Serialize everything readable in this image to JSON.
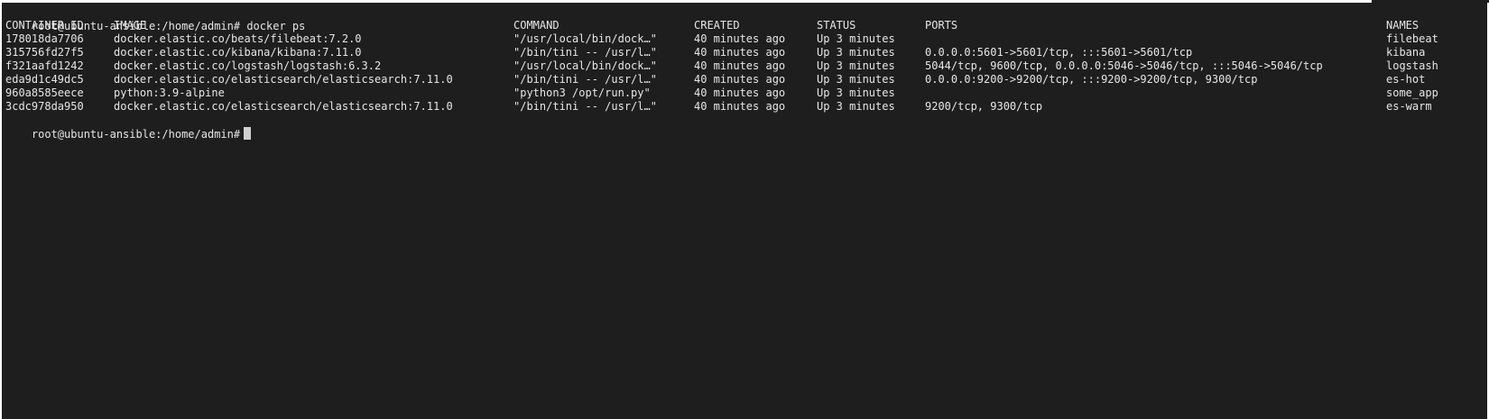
{
  "terminal": {
    "first_prompt": "root@ubuntu-ansible:/home/admin# docker ps",
    "last_prompt": "root@ubuntu-ansible:/home/admin#",
    "headers": {
      "container_id": "CONTAINER ID",
      "image": "IMAGE",
      "command": "COMMAND",
      "created": "CREATED",
      "status": "STATUS",
      "ports": "PORTS",
      "names": "NAMES"
    },
    "rows": [
      {
        "container_id": "178018da7706",
        "image": "docker.elastic.co/beats/filebeat:7.2.0",
        "command": "\"/usr/local/bin/dock…\"",
        "created": "40 minutes ago",
        "status": "Up 3 minutes",
        "ports": "",
        "names": "filebeat"
      },
      {
        "container_id": "315756fd27f5",
        "image": "docker.elastic.co/kibana/kibana:7.11.0",
        "command": "\"/bin/tini -- /usr/l…\"",
        "created": "40 minutes ago",
        "status": "Up 3 minutes",
        "ports": "0.0.0.0:5601->5601/tcp, :::5601->5601/tcp",
        "names": "kibana"
      },
      {
        "container_id": "f321aafd1242",
        "image": "docker.elastic.co/logstash/logstash:6.3.2",
        "command": "\"/usr/local/bin/dock…\"",
        "created": "40 minutes ago",
        "status": "Up 3 minutes",
        "ports": "5044/tcp, 9600/tcp, 0.0.0.0:5046->5046/tcp, :::5046->5046/tcp",
        "names": "logstash"
      },
      {
        "container_id": "eda9d1c49dc5",
        "image": "docker.elastic.co/elasticsearch/elasticsearch:7.11.0",
        "command": "\"/bin/tini -- /usr/l…\"",
        "created": "40 minutes ago",
        "status": "Up 3 minutes",
        "ports": "0.0.0.0:9200->9200/tcp, :::9200->9200/tcp, 9300/tcp",
        "names": "es-hot"
      },
      {
        "container_id": "960a8585eece",
        "image": "python:3.9-alpine",
        "command": "\"python3 /opt/run.py\"",
        "created": "40 minutes ago",
        "status": "Up 3 minutes",
        "ports": "",
        "names": "some_app"
      },
      {
        "container_id": "3cdc978da950",
        "image": "docker.elastic.co/elasticsearch/elasticsearch:7.11.0",
        "command": "\"/bin/tini -- /usr/l…\"",
        "created": "40 minutes ago",
        "status": "Up 3 minutes",
        "ports": "9200/tcp, 9300/tcp",
        "names": "es-warm"
      }
    ],
    "colors": {
      "background": "#1e1e1e",
      "foreground": "#e6e6e6",
      "cursor": "#d0d0d0"
    }
  }
}
